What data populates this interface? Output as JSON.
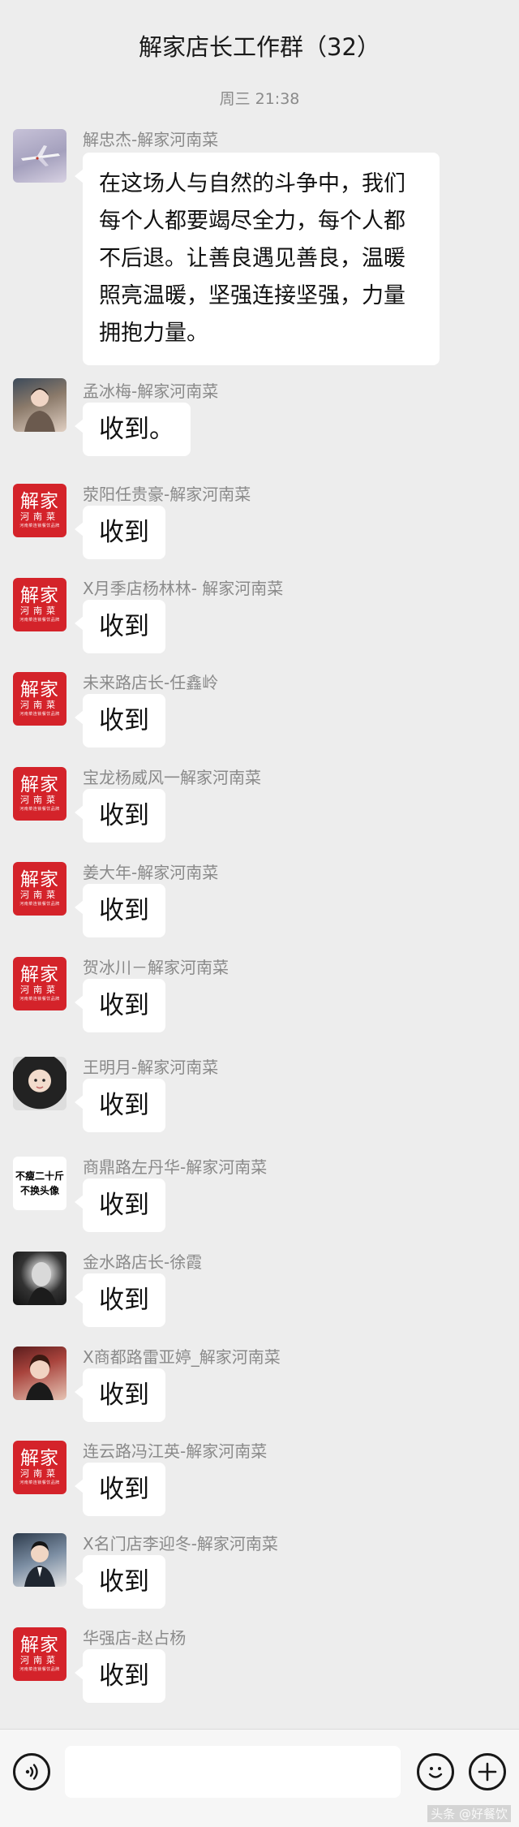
{
  "header": {
    "title": "解家店长工作群（32）"
  },
  "timestamp": "周三  21:38",
  "messages": [
    {
      "sender": "解忠杰-解家河南菜",
      "text": "在这场人与自然的斗争中，我们每个人都要竭尽全力，每个人都不后退。让善良遇见善良，温暖照亮温暖，坚强连接坚强，力量拥抱力量。"
    },
    {
      "sender": "孟冰梅-解家河南菜",
      "text": "收到。"
    },
    {
      "sender": "荥阳任贵豪-解家河南菜",
      "text": "收到"
    },
    {
      "sender": "X月季店杨林林- 解家河南菜",
      "text": "收到"
    },
    {
      "sender": "未来路店长-任鑫岭",
      "text": "收到"
    },
    {
      "sender": "宝龙杨威风一解家河南菜",
      "text": "收到"
    },
    {
      "sender": "姜大年-解家河南菜",
      "text": "收到"
    },
    {
      "sender": "贺冰川－解家河南菜",
      "text": "收到"
    },
    {
      "sender": "王明月-解家河南菜",
      "text": "收到"
    },
    {
      "sender": "商鼎路左丹华-解家河南菜",
      "text": "收到"
    },
    {
      "sender": "金水路店长-徐霞",
      "text": "收到"
    },
    {
      "sender": "X商都路雷亚婷_解家河南菜",
      "text": "收到"
    },
    {
      "sender": "连云路冯江英-解家河南菜",
      "text": "收到"
    },
    {
      "sender": "X名门店李迎冬-解家河南菜",
      "text": "收到"
    },
    {
      "sender": "华强店-赵占杨",
      "text": "收到"
    }
  ],
  "brand_avatar": {
    "line1": "解家",
    "line2": "河南菜",
    "line3": "河南菜连锁餐饮品牌"
  },
  "text_avatar": {
    "line1": "不瘦二十斤",
    "line2": "不换头像"
  },
  "toolbar": {
    "voice_icon": "voice-icon",
    "emoji_icon": "emoji-icon",
    "plus_icon": "plus-icon"
  },
  "watermark": "头条 @好餐饮",
  "colors": {
    "background": "#ededed",
    "bubble": "#ffffff",
    "brand_red": "#d4232a"
  }
}
